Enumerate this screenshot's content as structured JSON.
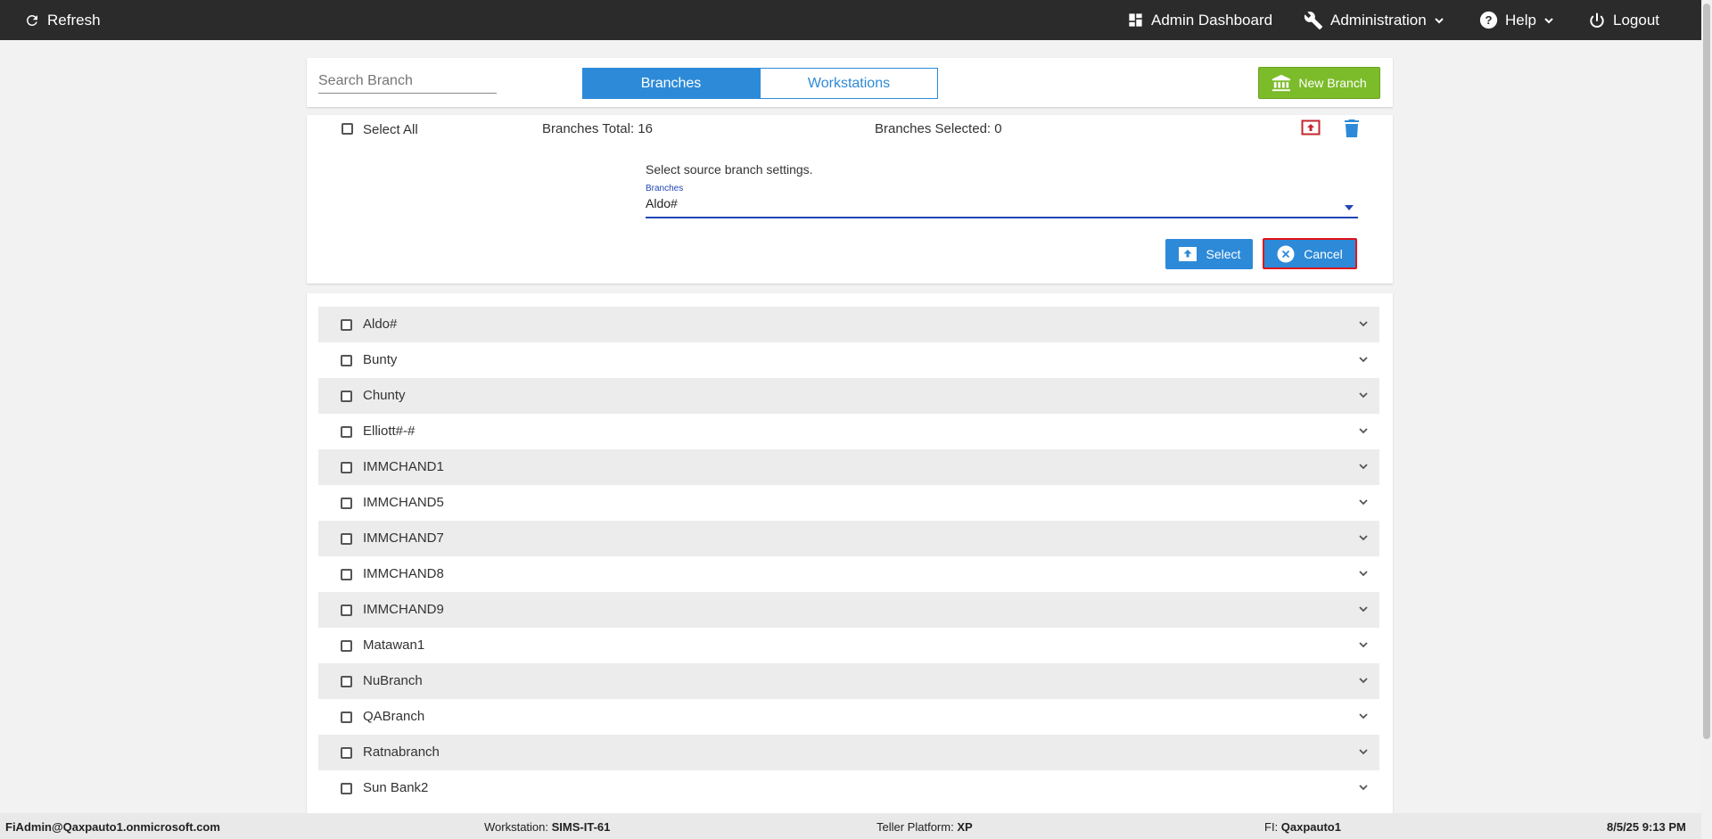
{
  "topbar": {
    "refresh": "Refresh",
    "admin_dashboard": "Admin Dashboard",
    "administration": "Administration",
    "help": "Help",
    "logout": "Logout"
  },
  "header": {
    "search_placeholder": "Search Branch",
    "tab_branches": "Branches",
    "tab_workstations": "Workstations",
    "new_branch": "New Branch"
  },
  "summary": {
    "select_all": "Select All",
    "branches_total": "Branches Total: 16",
    "branches_selected": "Branches Selected: 0"
  },
  "source_panel": {
    "prompt": "Select source branch settings.",
    "field_label": "Branches",
    "field_value": "Aldo#",
    "select_button": "Select",
    "cancel_button": "Cancel"
  },
  "branches": [
    {
      "name": "Aldo#"
    },
    {
      "name": "Bunty"
    },
    {
      "name": "Chunty"
    },
    {
      "name": "Elliott#-#"
    },
    {
      "name": "IMMCHAND1"
    },
    {
      "name": "IMMCHAND5"
    },
    {
      "name": "IMMCHAND7"
    },
    {
      "name": "IMMCHAND8"
    },
    {
      "name": "IMMCHAND9"
    },
    {
      "name": "Matawan1"
    },
    {
      "name": "NuBranch"
    },
    {
      "name": "QABranch"
    },
    {
      "name": "Ratnabranch"
    },
    {
      "name": "Sun Bank2"
    }
  ],
  "statusbar": {
    "user": "FiAdmin@Qaxpauto1.onmicrosoft.com",
    "workstation_label": "Workstation:",
    "workstation_value": "SIMS-IT-61",
    "platform_label": "Teller Platform:",
    "platform_value": "XP",
    "fi_label": "FI:",
    "fi_value": "Qaxpauto1",
    "datetime": "8/5/25 9:13 PM"
  },
  "colors": {
    "topbar": "#2b2b2b",
    "accent_blue": "#2d8ad8",
    "new_branch_green": "#7cbb2a",
    "cancel_outline_red": "#e0121b",
    "upload_icon_red": "#c4262e"
  }
}
